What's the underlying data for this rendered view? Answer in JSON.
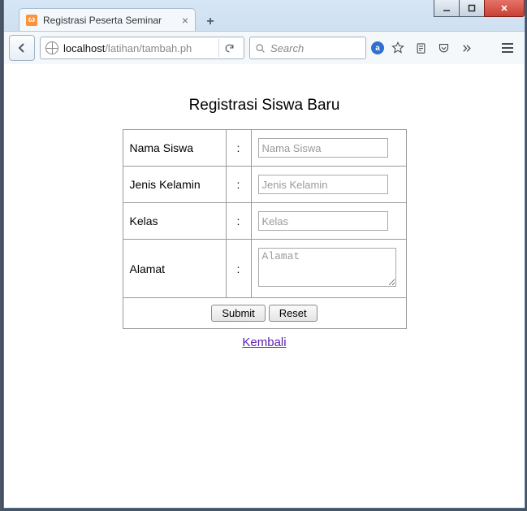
{
  "window": {
    "tab_title": "Registrasi Peserta Seminar"
  },
  "navbar": {
    "url_host": "localhost",
    "url_path": "/latihan/tambah.ph",
    "search_placeholder": "Search"
  },
  "page": {
    "heading": "Registrasi Siswa Baru",
    "back_link": "Kembali",
    "submit_label": "Submit",
    "reset_label": "Reset",
    "fields": {
      "nama": {
        "label": "Nama Siswa",
        "placeholder": "Nama Siswa"
      },
      "jk": {
        "label": "Jenis Kelamin",
        "placeholder": "Jenis Kelamin"
      },
      "kelas": {
        "label": "Kelas",
        "placeholder": "Kelas"
      },
      "alamat": {
        "label": "Alamat",
        "placeholder": "Alamat"
      }
    }
  }
}
